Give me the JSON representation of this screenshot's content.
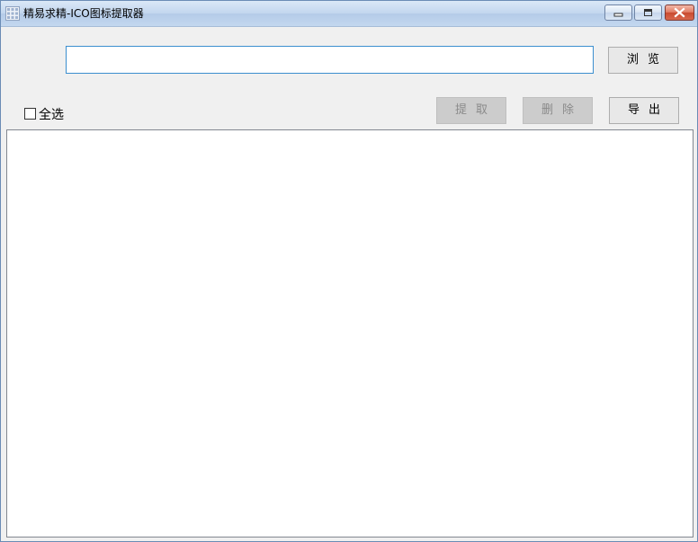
{
  "window": {
    "title": "精易求精-ICO图标提取器",
    "icon": "app-grid-icon"
  },
  "titlebar_buttons": {
    "minimize_icon": "minimize-icon",
    "maximize_icon": "maximize-icon",
    "close_icon": "close-icon"
  },
  "path_input": {
    "value": "",
    "placeholder": ""
  },
  "buttons": {
    "browse": "浏览",
    "extract": "提取",
    "delete": "删除",
    "export": "导出"
  },
  "select_all": {
    "label": "全选",
    "checked": false
  },
  "colors": {
    "input_focus_border": "#3c8fcf",
    "disabled_button": "#cccccc",
    "close_button": "#c84a30"
  }
}
